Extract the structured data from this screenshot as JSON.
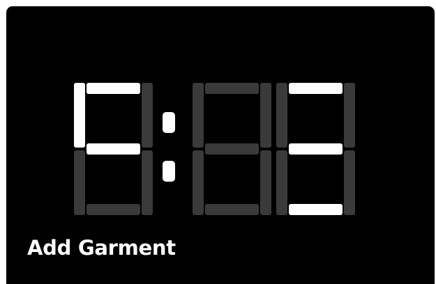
{
  "display": {
    "digits": [
      "",
      "",
      ""
    ],
    "lit_segments": [
      [
        "a",
        "f",
        "g"
      ],
      [],
      [
        "a",
        "g",
        "d"
      ]
    ],
    "colon_visible": true,
    "on_color": "#ffffff",
    "off_color": "#3a3a3a",
    "background": "#000000"
  },
  "label": "Add Garment"
}
